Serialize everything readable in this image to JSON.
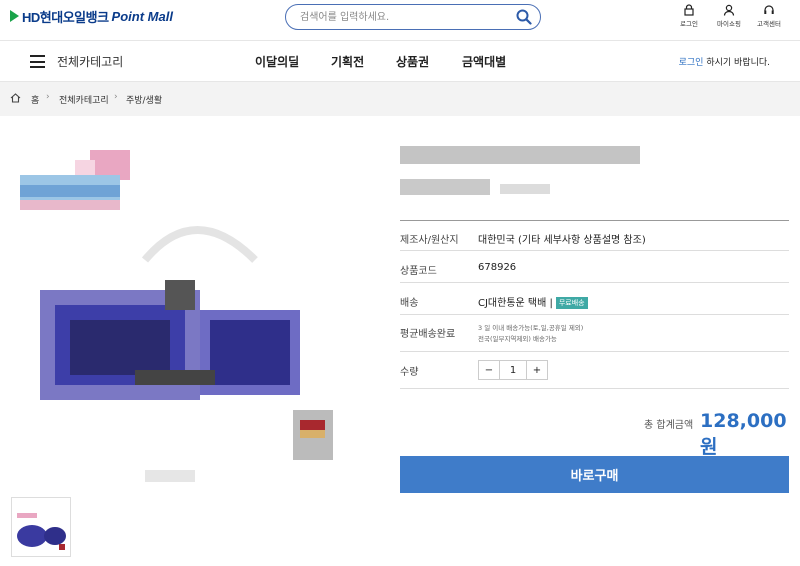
{
  "header": {
    "logo_brand": "HD현대오일뱅크",
    "logo_suffix": "Point Mall",
    "search_placeholder": "검색어를 입력하세요.",
    "util": [
      {
        "label": "로그인",
        "icon": "lock-icon"
      },
      {
        "label": "마이쇼핑",
        "icon": "person-icon"
      },
      {
        "label": "고객센터",
        "icon": "headset-icon"
      }
    ]
  },
  "gnb": {
    "all_category": "전체카테고리",
    "menu": [
      "이달의딜",
      "기획전",
      "상품권",
      "금액대별"
    ],
    "login_link": "로그인",
    "login_msg": " 하시기 바랍니다."
  },
  "breadcrumb": [
    "홈",
    "전체카테고리",
    "주방/생활"
  ],
  "product": {
    "rows": [
      {
        "label": "제조사/원산지",
        "value": "대한민국 (기타 세부사항 상품설명 참조)"
      },
      {
        "label": "상품코드",
        "value": "678926"
      },
      {
        "label": "배송",
        "value": "CJ대한통운 택배 |",
        "badge": "무료배송"
      },
      {
        "label": "평균배송완료",
        "line1": "3 일 이내 배송가능(토,일,공휴일 제외)",
        "line2": "전국(일부지역제외) 배송가능"
      },
      {
        "label": "수량"
      }
    ],
    "qty": {
      "minus": "−",
      "value": "1",
      "plus": "+"
    },
    "total_label": "총 합계금액",
    "total_value": "128,000원",
    "buy_label": "바로구매"
  },
  "colors": {
    "accent": "#2c6fc2",
    "buy": "#3f7cc9",
    "badge": "#3fa9a5"
  }
}
